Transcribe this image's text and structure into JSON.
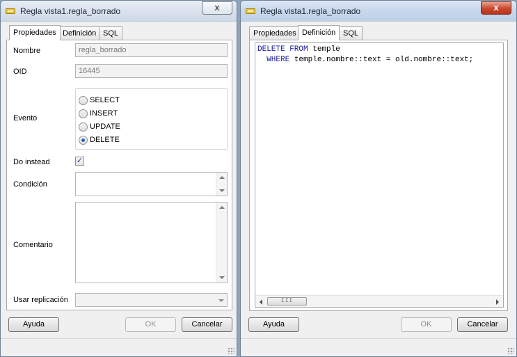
{
  "left_window": {
    "title": "Regla vista1.regla_borrado",
    "close_glyph": "x",
    "tabs": [
      "Propiedades",
      "Definición",
      "SQL"
    ],
    "active_tab": "Propiedades",
    "fields": {
      "nombre_label": "Nombre",
      "nombre_value": "regla_borrado",
      "oid_label": "OID",
      "oid_value": "16445",
      "evento_label": "Evento",
      "evento_options": [
        "SELECT",
        "INSERT",
        "UPDATE",
        "DELETE"
      ],
      "evento_selected": "DELETE",
      "do_instead_label": "Do instead",
      "do_instead_checked": true,
      "condicion_label": "Condición",
      "comentario_label": "Comentario",
      "usar_replicacion_label": "Usar replicación"
    },
    "buttons": {
      "help": "Ayuda",
      "ok": "OK",
      "cancel": "Cancelar"
    }
  },
  "right_window": {
    "title": "Regla vista1.regla_borrado",
    "close_glyph": "x",
    "tabs": [
      "Propiedades",
      "Definición",
      "SQL"
    ],
    "active_tab": "Definición",
    "code": {
      "line1_kw": "DELETE FROM",
      "line1_rest": " temple",
      "line2_indent": "  ",
      "line2_kw": "WHERE",
      "line2_rest": " temple.nombre::text = old.nombre::text;"
    },
    "scroll_thumb_grip": "III",
    "buttons": {
      "help": "Ayuda",
      "ok": "OK",
      "cancel": "Cancelar"
    }
  },
  "colors": {
    "keyword": "#1a1aa6",
    "close_active": "#c9472d",
    "radio_selected": "#1e64c8"
  },
  "icons": {
    "window_icon": "rule-icon",
    "close": "close-icon",
    "check": "checkmark-icon"
  }
}
